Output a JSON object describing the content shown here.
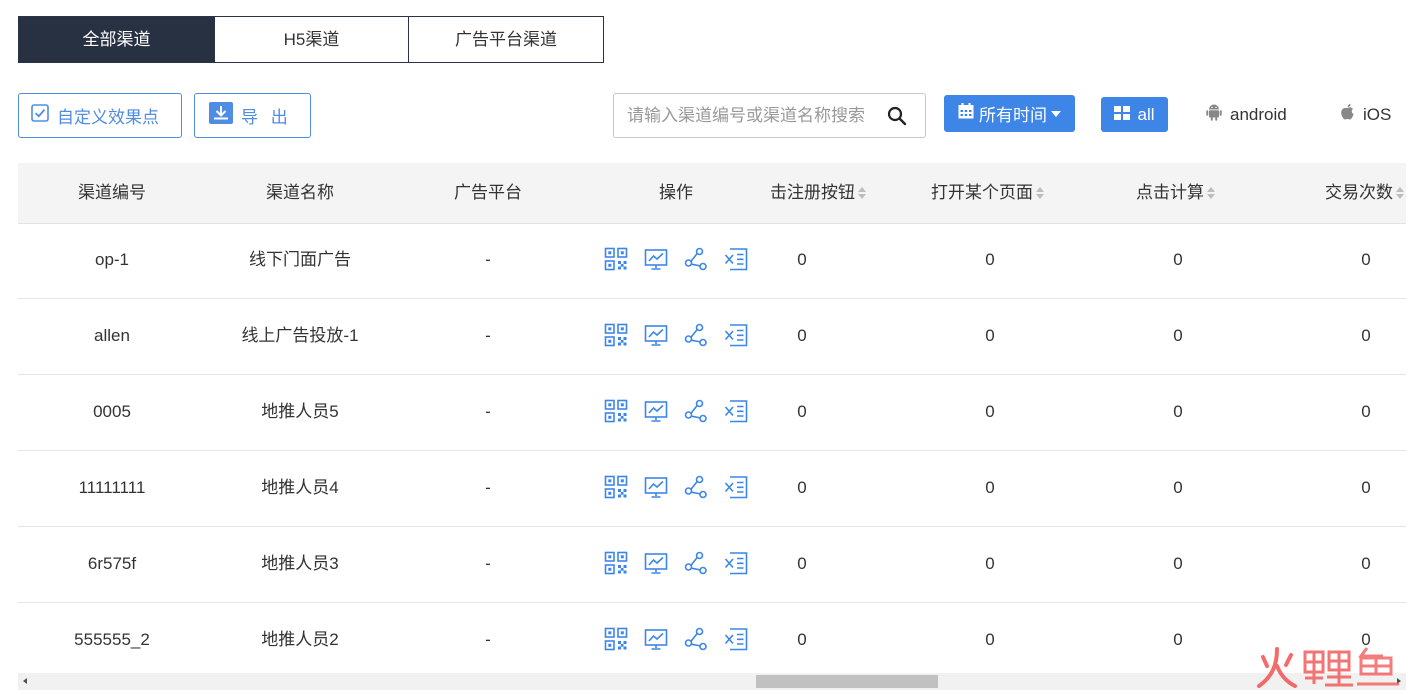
{
  "tabs": [
    {
      "label": "全部渠道",
      "active": true
    },
    {
      "label": "H5渠道",
      "active": false
    },
    {
      "label": "广告平台渠道",
      "active": false
    }
  ],
  "toolbar": {
    "custom_label": "自定义效果点",
    "export_label": "导 出",
    "search_placeholder": "请输入渠道编号或渠道名称搜索",
    "time_label": "所有时间",
    "platforms": {
      "all": "all",
      "android": "android",
      "ios": "iOS"
    }
  },
  "colors": {
    "accent": "#3d86e8",
    "tab_active": "#283142",
    "outline": "#4e8de3"
  },
  "table": {
    "headers": {
      "code": "渠道编号",
      "name": "渠道名称",
      "platform": "广告平台",
      "ops": "操作",
      "reg": "击注册按钮",
      "open": "打开某个页面",
      "click": "点击计算",
      "trade": "交易次数"
    },
    "op_icons": [
      "qrcode-icon",
      "chart-icon",
      "share-icon",
      "export-data-icon"
    ],
    "rows": [
      {
        "code": "op-1",
        "name": "线下门面广告",
        "platform": "-",
        "reg": "0",
        "open": "0",
        "click": "0",
        "trade": "0"
      },
      {
        "code": "allen",
        "name": "线上广告投放-1",
        "platform": "-",
        "reg": "0",
        "open": "0",
        "click": "0",
        "trade": "0"
      },
      {
        "code": "0005",
        "name": "地推人员5",
        "platform": "-",
        "reg": "0",
        "open": "0",
        "click": "0",
        "trade": "0"
      },
      {
        "code": "11111111",
        "name": "地推人员4",
        "platform": "-",
        "reg": "0",
        "open": "0",
        "click": "0",
        "trade": "0"
      },
      {
        "code": "6r575f",
        "name": "地推人员3",
        "platform": "-",
        "reg": "0",
        "open": "0",
        "click": "0",
        "trade": "0"
      },
      {
        "code": "555555_2",
        "name": "地推人员2",
        "platform": "-",
        "reg": "0",
        "open": "0",
        "click": "0",
        "trade": "0"
      }
    ]
  },
  "watermark": {
    "text": "火鲤鱼"
  }
}
